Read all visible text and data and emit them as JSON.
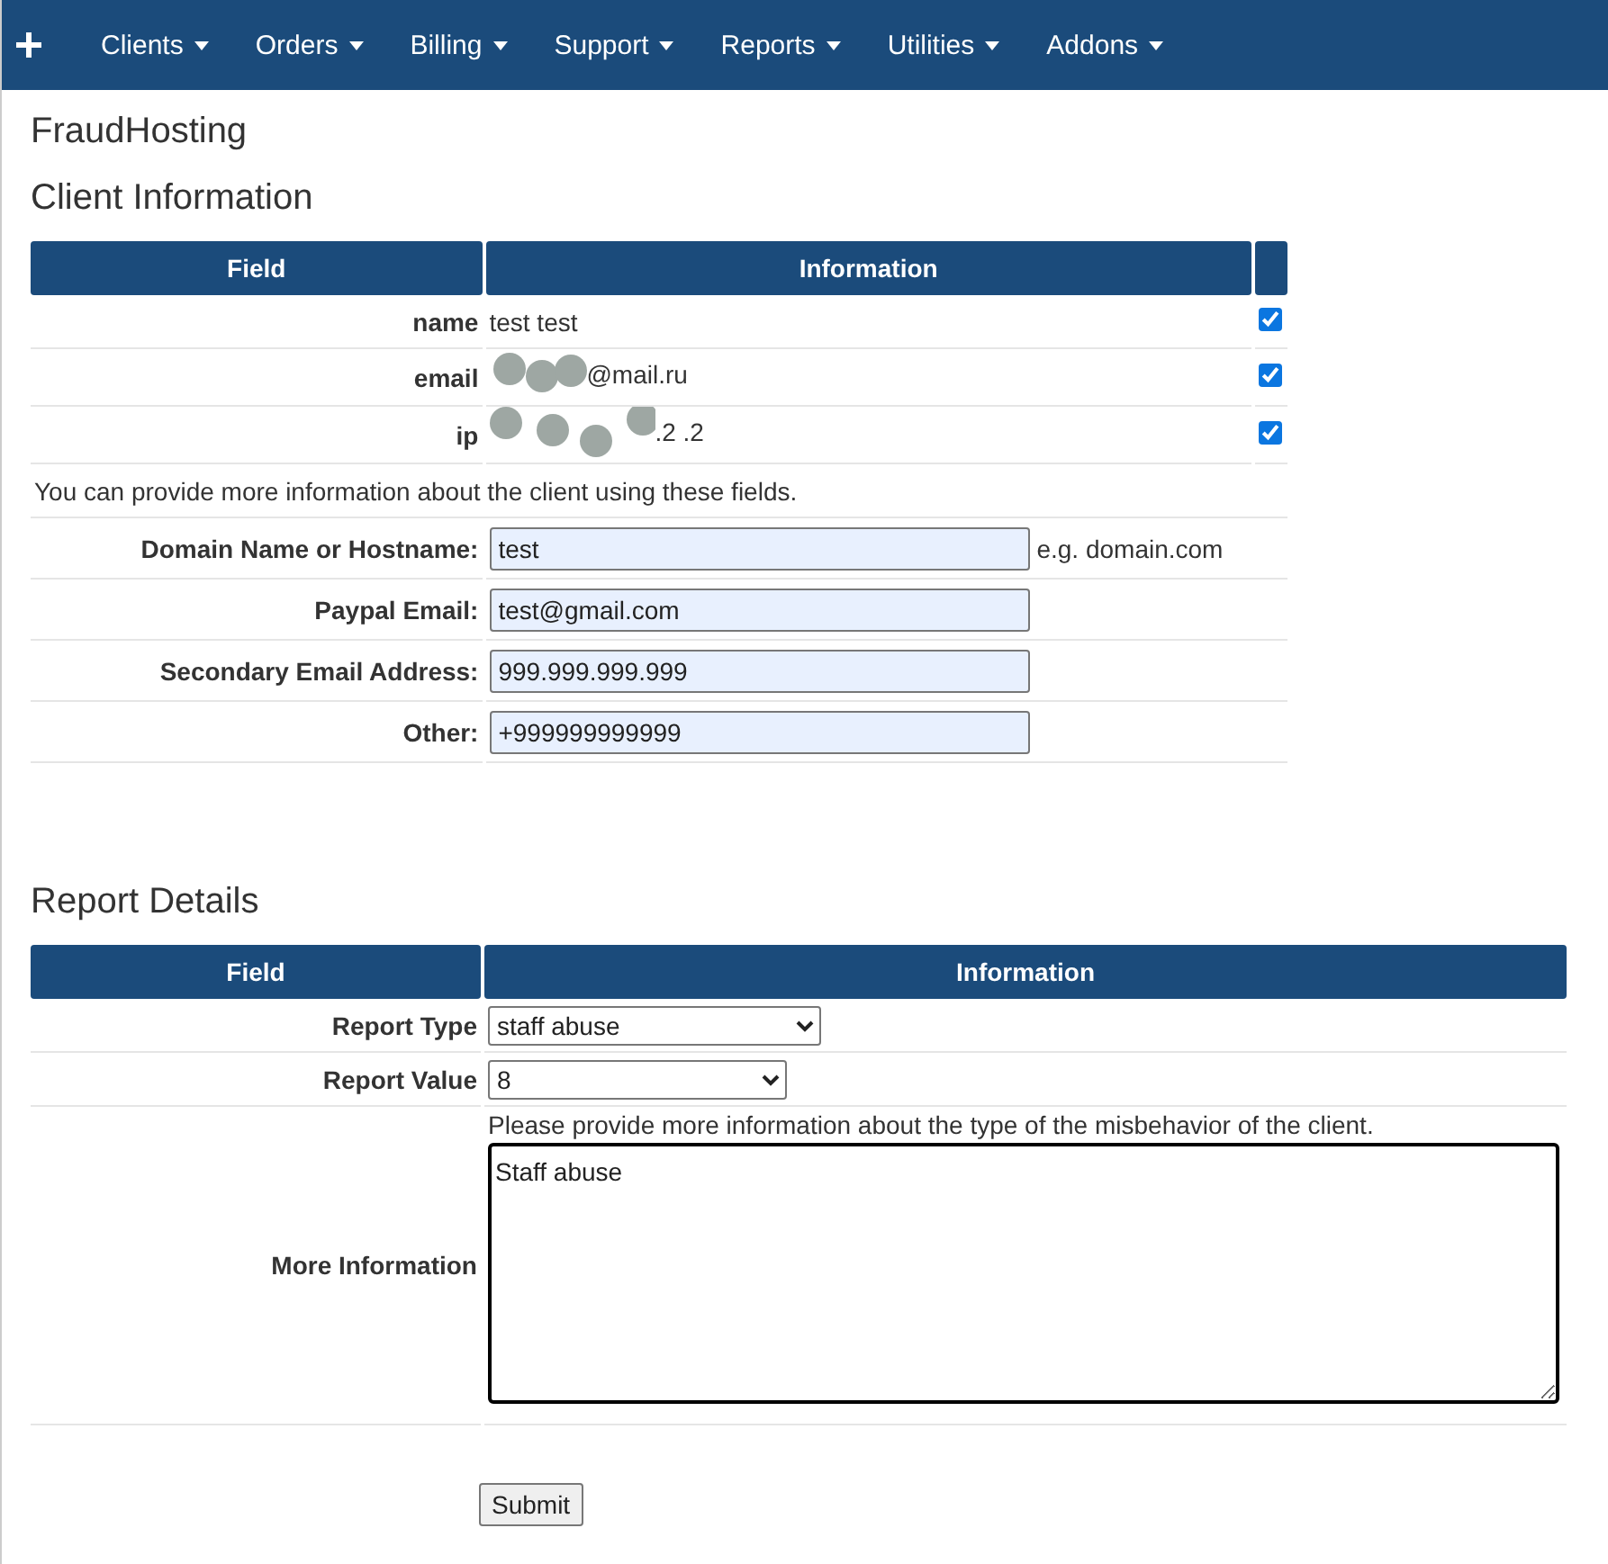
{
  "nav": {
    "items": [
      {
        "label": "Clients"
      },
      {
        "label": "Orders"
      },
      {
        "label": "Billing"
      },
      {
        "label": "Support"
      },
      {
        "label": "Reports"
      },
      {
        "label": "Utilities"
      },
      {
        "label": "Addons"
      }
    ]
  },
  "site_title": "FraudHosting",
  "client_info": {
    "title": "Client Information",
    "columns": [
      "Field",
      "Information"
    ],
    "rows": [
      {
        "field": "name",
        "value": "test test",
        "redacted": false,
        "checked": true
      },
      {
        "field": "email",
        "value": "@mail.ru",
        "redacted": true,
        "checked": true
      },
      {
        "field": "ip",
        "value": ".2  .2",
        "redacted": true,
        "checked": true
      }
    ],
    "note": "You can provide more information about the client using these fields.",
    "fields": [
      {
        "label": "Domain Name or Hostname:",
        "value": "test",
        "hint": "e.g. domain.com"
      },
      {
        "label": "Paypal Email:",
        "value": "test@gmail.com"
      },
      {
        "label": "Secondary Email Address:",
        "value": "999.999.999.999"
      },
      {
        "label": "Other:",
        "value": "+999999999999"
      }
    ]
  },
  "report": {
    "title": "Report Details",
    "columns": [
      "Field",
      "Information"
    ],
    "report_type": {
      "label": "Report Type",
      "value": "staff abuse"
    },
    "report_value": {
      "label": "Report Value",
      "value": "8"
    },
    "more_info": {
      "label": "More Information",
      "note": "Please provide more information about the type of the misbehavior of the client.",
      "value": "Staff abuse"
    },
    "submit": "Submit"
  }
}
